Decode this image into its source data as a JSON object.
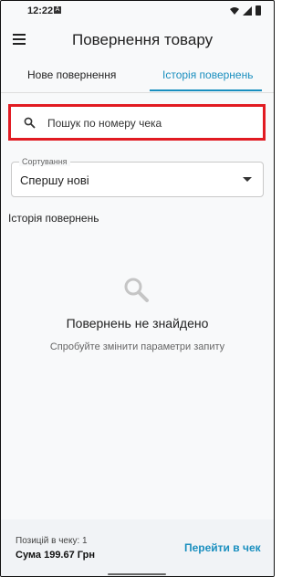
{
  "status": {
    "time": "12:22",
    "badge": "A"
  },
  "appbar": {
    "title": "Повернення товару"
  },
  "tabs": {
    "new_label": "Нове повернення",
    "history_label": "Історія повернень"
  },
  "search": {
    "placeholder": "Пошук по номеру чека"
  },
  "sort": {
    "label": "Сортування",
    "value": "Спершу нові"
  },
  "history": {
    "title": "Історія повернень"
  },
  "empty": {
    "title": "Повернень не знайдено",
    "subtitle": "Спробуйте змінити параметри запиту"
  },
  "bottom": {
    "positions": "Позицій в чеку: 1",
    "sum": "Сума 199.67 Грн",
    "go_label": "Перейти в чек"
  },
  "colors": {
    "accent": "#1a8fbf",
    "highlight": "#e11b22"
  },
  "icons": [
    "menu-icon",
    "search-icon",
    "caret-down-icon",
    "empty-search-icon",
    "wifi-icon",
    "signal-icon",
    "battery-icon"
  ]
}
